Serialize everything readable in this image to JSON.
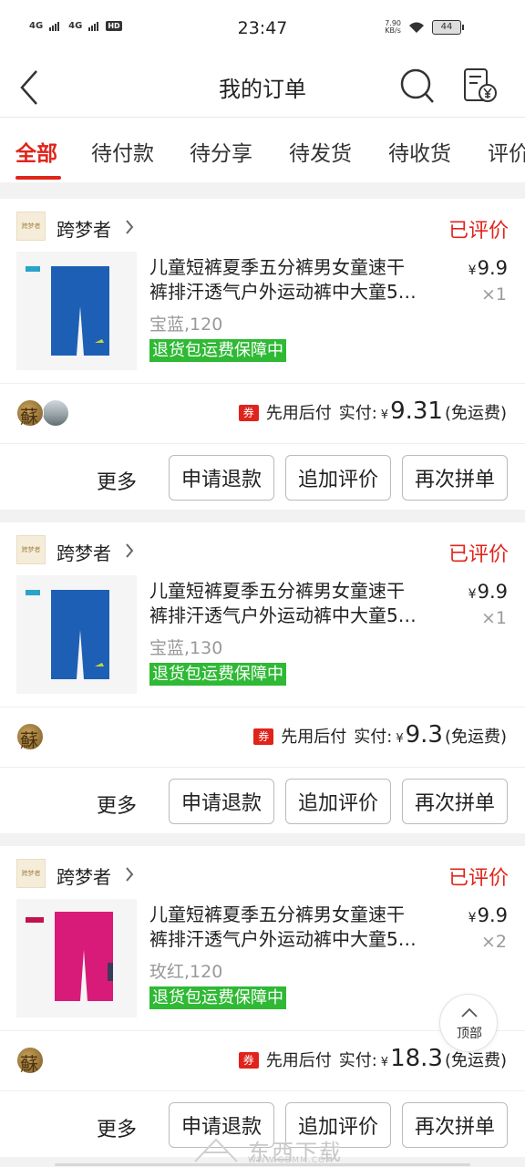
{
  "status_bar": {
    "time": "23:47",
    "net1": "4G",
    "net2": "4G",
    "hd": "HD",
    "speed_value": "7.90",
    "speed_unit": "KB/s",
    "battery": "44"
  },
  "nav": {
    "title": "我的订单"
  },
  "tabs": [
    {
      "label": "全部",
      "active": true
    },
    {
      "label": "待付款"
    },
    {
      "label": "待分享"
    },
    {
      "label": "待发货"
    },
    {
      "label": "待收货"
    },
    {
      "label": "评价"
    }
  ],
  "orders": [
    {
      "shop": "跨梦者",
      "shop_logo": "跨梦者",
      "status": "已评价",
      "title_line1": "儿童短裤夏季五分裤男女童速干",
      "title_line2": "裤排汗透气户外运动裤中大童5…",
      "spec": "宝蓝,120",
      "badge": "退货包运费保障中",
      "price_symbol": "¥",
      "price": "9.9",
      "qty": "×1",
      "coupon": "券",
      "pay_label": "先用后付",
      "paid_label": "实付:",
      "amount_symbol": "¥",
      "amount": "9.31",
      "shipping": "(免运费)",
      "more": "更多",
      "btn1": "申请退款",
      "btn2": "追加评价",
      "btn3": "再次拼单",
      "product_color": "#1d5fb4"
    },
    {
      "shop": "跨梦者",
      "shop_logo": "跨梦者",
      "status": "已评价",
      "title_line1": "儿童短裤夏季五分裤男女童速干",
      "title_line2": "裤排汗透气户外运动裤中大童5…",
      "spec": "宝蓝,130",
      "badge": "退货包运费保障中",
      "price_symbol": "¥",
      "price": "9.9",
      "qty": "×1",
      "coupon": "券",
      "pay_label": "先用后付",
      "paid_label": "实付:",
      "amount_symbol": "¥",
      "amount": "9.3",
      "shipping": "(免运费)",
      "more": "更多",
      "btn1": "申请退款",
      "btn2": "追加评价",
      "btn3": "再次拼单",
      "product_color": "#1d5fb4"
    },
    {
      "shop": "跨梦者",
      "shop_logo": "跨梦者",
      "status": "已评价",
      "title_line1": "儿童短裤夏季五分裤男女童速干",
      "title_line2": "裤排汗透气户外运动裤中大童5…",
      "spec": "玫红,120",
      "badge": "退货包运费保障中",
      "price_symbol": "¥",
      "price": "9.9",
      "qty": "×2",
      "coupon": "券",
      "pay_label": "先用后付",
      "paid_label": "实付:",
      "amount_symbol": "¥",
      "amount": "18.3",
      "shipping": "(免运费)",
      "more": "更多",
      "btn1": "申请退款",
      "btn2": "追加评价",
      "btn3": "再次拼单",
      "product_color": "#d81b78"
    }
  ],
  "avatar_glyph": "蘇",
  "back_to_top": "顶部",
  "watermark": "东西下载",
  "watermark_url": "WWW.GDMM.COM",
  "colors": {
    "accent": "#e0241b",
    "badge_green": "#2fb935"
  }
}
